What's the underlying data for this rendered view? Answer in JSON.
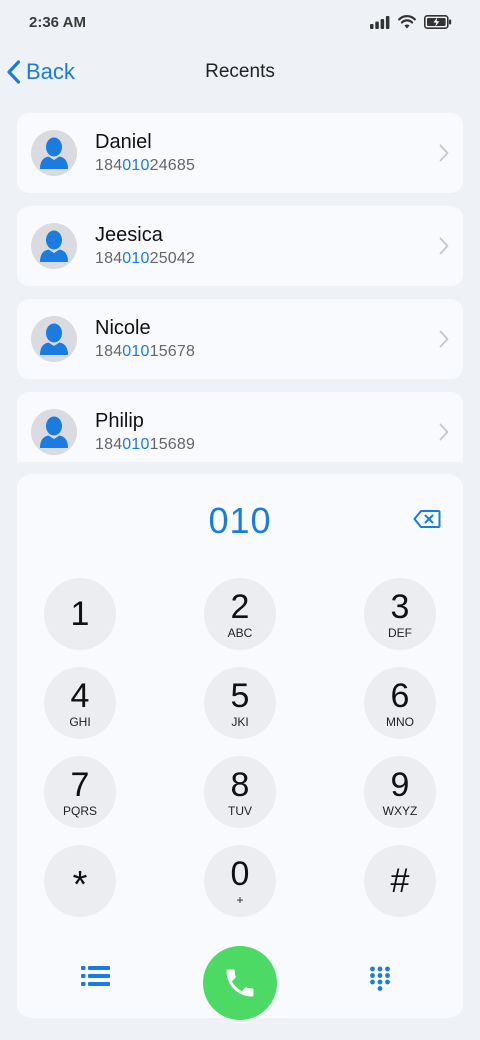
{
  "status_bar": {
    "time": "2:36 AM"
  },
  "nav": {
    "back_label": "Back",
    "title": "Recents"
  },
  "recents": [
    {
      "name": "Daniel",
      "number_prefix": "184",
      "number_match": "010",
      "number_suffix": "24685"
    },
    {
      "name": "Jeesica",
      "number_prefix": "184",
      "number_match": "010",
      "number_suffix": "25042"
    },
    {
      "name": "Nicole",
      "number_prefix": "184",
      "number_match": "010",
      "number_suffix": "15678"
    },
    {
      "name": "Philip",
      "number_prefix": "184",
      "number_match": "010",
      "number_suffix": "15689"
    }
  ],
  "dialer": {
    "dialed_number": "010",
    "keys": [
      {
        "digit": "1",
        "letters": ""
      },
      {
        "digit": "2",
        "letters": "ABC"
      },
      {
        "digit": "3",
        "letters": "DEF"
      },
      {
        "digit": "4",
        "letters": "GHI"
      },
      {
        "digit": "5",
        "letters": "JKI"
      },
      {
        "digit": "6",
        "letters": "MNO"
      },
      {
        "digit": "7",
        "letters": "PQRS"
      },
      {
        "digit": "8",
        "letters": "TUV"
      },
      {
        "digit": "9",
        "letters": "WXYZ"
      },
      {
        "digit": "*",
        "letters": ""
      },
      {
        "digit": "0",
        "letters": "+"
      },
      {
        "digit": "#",
        "letters": ""
      }
    ]
  },
  "colors": {
    "accent": "#1a7be0",
    "call": "#4cd964",
    "background": "#eef1f6",
    "card": "#f9fafd"
  },
  "icons": {
    "back": "chevron-left-icon",
    "avatar": "person-icon",
    "row_chevron": "chevron-right-icon",
    "backspace": "backspace-icon",
    "list": "list-icon",
    "call": "phone-icon",
    "keypad": "keypad-icon"
  }
}
